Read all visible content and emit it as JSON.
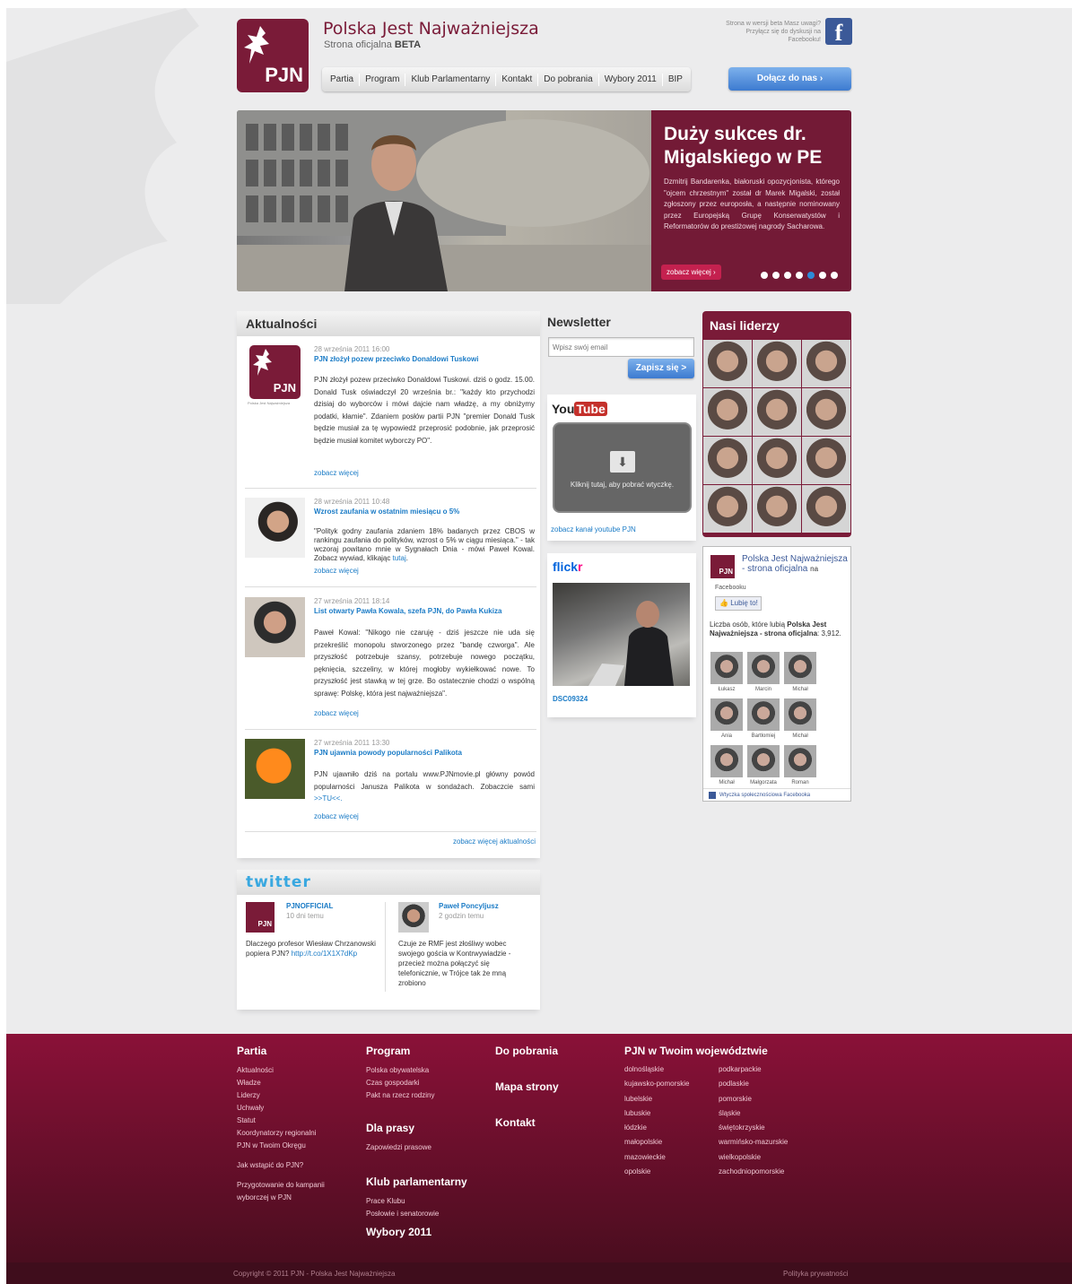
{
  "header": {
    "title": "Polska Jest Najważniejsza",
    "subtitle_prefix": "Strona oficjalna",
    "subtitle_beta": "BETA",
    "logo_text": "PJN",
    "beta_note": "Strona w wersji beta Masz uwagi? Przyłącz się do dyskusji na Facebooku!",
    "fb_letter": "f",
    "join_button": "Dołącz do nas ›"
  },
  "nav": [
    "Partia",
    "Program",
    "Klub Parlamentarny",
    "Kontakt",
    "Do pobrania",
    "Wybory 2011",
    "BIP"
  ],
  "slider": {
    "title": "Duży sukces dr. Migalskiego w PE",
    "text": "Dzmitrij Bandarenka, białoruski opozycjonista, którego \"ojcem chrzestnym\" został dr Marek Migalski, został zgłoszony przez europosła, a następnie nominowany przez Europejską Grupę Konserwatystów i Reformatorów do prestiżowej nagrody Sacharowa.",
    "more": "zobacz więcej ›",
    "dots_total": 7,
    "dot_active": 5
  },
  "news": {
    "heading": "Aktualności",
    "logo_text": "PJN",
    "logo_caption": "Polska Jest Najważniejsza",
    "items": [
      {
        "date": "28 września 2011 16:00",
        "title": "PJN złożył pozew przeciwko Donaldowi Tuskowi",
        "body": "PJN złożył pozew przeciwko Donaldowi Tuskowi. dziś o godz. 15.00. Donald Tusk oświadczył 20 września br.: \"każdy kto przychodzi dzisiaj do wyborców i mówi dajcie nam władzę, a my obniżymy podatki, kłamie\". Zdaniem posłów partii PJN \"premier Donald Tusk będzie musiał za tę wypowiedź przeprosić podobnie, jak przeprosić będzie musiał komitet wyborczy PO\".",
        "more": "zobacz więcej"
      },
      {
        "date": "28 września 2011 10:48",
        "title": "Wzrost zaufania w ostatnim miesiącu o 5%",
        "body": "\"Polityk godny zaufania zdaniem 18% badanych przez CBOS w rankingu zaufania do polityków, wzrost o 5% w ciągu miesiąca.\" - tak wczoraj powitano mnie w Sygnałach Dnia - mówi Paweł Kowal. Zobacz wywiad, klikając",
        "link": "tutaj",
        "more": "zobacz więcej"
      },
      {
        "date": "27 września 2011 18:14",
        "title": "List otwarty Pawła Kowala, szefa PJN, do Pawła Kukiza",
        "body": "Paweł Kowal: \"Nikogo nie czaruję - dziś jeszcze nie uda się przekreślić monopolu stworzonego przez \"bandę czworga\". Ale przyszłość potrzebuje szansy, potrzebuje nowego początku, pęknięcia, szczeliny, w której mogłoby wykiełkować nowe. To przyszłość jest stawką w tej grze. Bo ostatecznie chodzi o wspólną sprawę: Polskę, która jest najważniejsza\".",
        "more": "zobacz więcej"
      },
      {
        "date": "27 września 2011 13:30",
        "title": "PJN ujawnia powody popularności Palikota",
        "body": "PJN ujawniło dziś na portalu www.PJNmovie.pl główny powód popularności Janusza Palikota w sondażach. Zobaczcie sami",
        "link": ">>TU<<.",
        "more": "zobacz więcej"
      }
    ],
    "all": "zobacz więcej aktualności"
  },
  "twitter": {
    "logo": "twitter",
    "tweets": [
      {
        "name": "PJNOFFICIAL",
        "time": "10 dni temu",
        "text": "Dlaczego profesor Wiesław Chrzanowski popiera PJN?",
        "link": "http://t.co/1X1X7dKp",
        "avatar_text": "PJN"
      },
      {
        "name": "Paweł Poncyljusz",
        "time": "2 godzin temu",
        "text": "Czuje ze RMF jest złośliwy wobec swojego gościa w Kontrwywiadzie - przecież można połączyć się telefonicznie, w Trójce tak że mną zrobiono"
      }
    ]
  },
  "newsletter": {
    "heading": "Newsletter",
    "placeholder": "Wpisz swój email",
    "button": "Zapisz się >"
  },
  "youtube": {
    "logo_you": "You",
    "logo_tube": "Tube",
    "plugin_text": "Kliknij tutaj, aby pobrać wtyczkę.",
    "plugin_icon": "⬇",
    "link": "zobacz kanał youtube PJN"
  },
  "flickr": {
    "logo_a": "flick",
    "logo_b": "r",
    "caption": "DSC09324"
  },
  "leaders": {
    "heading": "Nasi liderzy",
    "count": 12
  },
  "facebook_box": {
    "logo_text": "PJN",
    "page_name": "Polska Jest Najważniejsza - strona oficjalna",
    "on": "na",
    "facebook": "Facebooku",
    "like": "Lubię to!",
    "count_prefix": "Liczba osób, które lubią",
    "count_page": "Polska Jest Najważniejsza - strona oficjalna",
    "count_value": "3,912.",
    "faces": [
      "Łukasz",
      "Marcin",
      "Michał",
      "Ania",
      "Bartłomiej",
      "Michał",
      "Michał",
      "Małgorzata",
      "Roman"
    ],
    "footer": "Wtyczka społecznościowa Facebooka"
  },
  "footer": {
    "partia": {
      "heading": "Partia",
      "links": [
        "Aktualności",
        "Władze",
        "Liderzy",
        "Uchwały",
        "Statut",
        "Koordynatorzy regionalni",
        "PJN w Twoim Okręgu"
      ],
      "links2": [
        "Jak wstąpić do PJN?"
      ],
      "links3": [
        "Przygotowanie do kampanii",
        "wyborczej w PJN"
      ]
    },
    "program": {
      "heading": "Program",
      "links": [
        "Polska obywatelska",
        "Czas gospodarki",
        "Pakt na rzecz rodziny"
      ],
      "prasa_heading": "Dla prasy",
      "prasa_links": [
        "Zapowiedzi prasowe"
      ],
      "klub_heading": "Klub parlamentarny",
      "klub_links": [
        "Prace Klubu",
        "Posłowie i senatorowie"
      ],
      "wybory_heading": "Wybory 2011"
    },
    "misc": {
      "pobrania": "Do pobrania",
      "mapa": "Mapa strony",
      "kontakt": "Kontakt"
    },
    "woj": {
      "heading": "PJN w Twoim województwie",
      "col1": [
        "dolnośląskie",
        "kujawsko-pomorskie",
        "lubelskie",
        "lubuskie",
        "łódzkie",
        "małopolskie",
        "mazowieckie",
        "opolskie"
      ],
      "col2": [
        "podkarpackie",
        "podlaskie",
        "pomorskie",
        "śląskie",
        "świętokrzyskie",
        "warmińsko-mazurskie",
        "wielkopolskie",
        "zachodniopomorskie"
      ]
    },
    "copyright": "Copyright © 2011 PJN - Polska Jest Najważniejsza",
    "privacy": "Polityka prywatności"
  },
  "colors": {
    "brand": "#7a1b38",
    "link": "#1a7bc6",
    "button": "#3c7ad0"
  }
}
